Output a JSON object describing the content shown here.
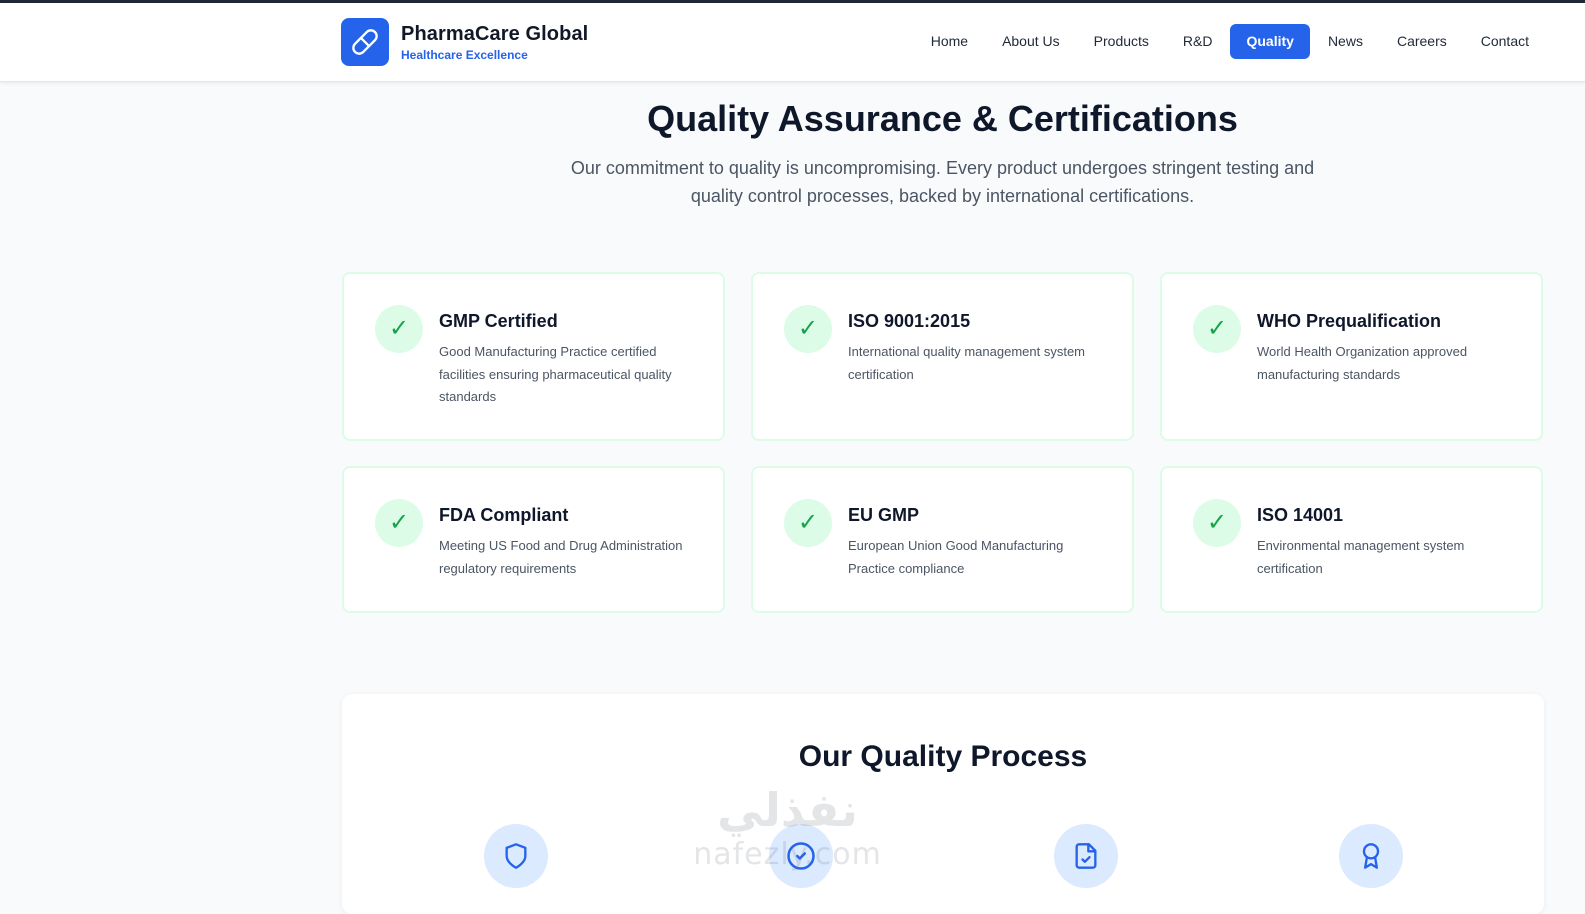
{
  "brand": {
    "name": "PharmaCare Global",
    "tagline": "Healthcare Excellence",
    "logo_icon": "pill-icon",
    "accent_color": "#2563eb"
  },
  "nav": {
    "items": [
      {
        "label": "Home",
        "active": false
      },
      {
        "label": "About Us",
        "active": false
      },
      {
        "label": "Products",
        "active": false
      },
      {
        "label": "R&D",
        "active": false
      },
      {
        "label": "Quality",
        "active": true
      },
      {
        "label": "News",
        "active": false
      },
      {
        "label": "Careers",
        "active": false
      },
      {
        "label": "Contact",
        "active": false
      }
    ]
  },
  "hero": {
    "title": "Quality Assurance & Certifications",
    "subtitle": "Our commitment to quality is uncompromising. Every product undergoes stringent testing and quality control processes, backed by international certifications."
  },
  "certifications": [
    {
      "check": "✓",
      "title": "GMP Certified",
      "description": "Good Manufacturing Practice certified facilities ensuring pharmaceutical quality standards"
    },
    {
      "check": "✓",
      "title": "ISO 9001:2015",
      "description": "International quality management system certification"
    },
    {
      "check": "✓",
      "title": "WHO Prequalification",
      "description": "World Health Organization approved manufacturing standards"
    },
    {
      "check": "✓",
      "title": "FDA Compliant",
      "description": "Meeting US Food and Drug Administration regulatory requirements"
    },
    {
      "check": "✓",
      "title": "EU GMP",
      "description": "European Union Good Manufacturing Practice compliance"
    },
    {
      "check": "✓",
      "title": "ISO 14001",
      "description": "Environmental management system certification"
    }
  ],
  "process": {
    "title": "Our Quality Process",
    "step_icons": [
      "shield-icon",
      "check-circle-icon",
      "file-check-icon",
      "award-icon"
    ]
  },
  "watermark": {
    "arabic": "نفذلي",
    "latin": "nafezly.com"
  }
}
